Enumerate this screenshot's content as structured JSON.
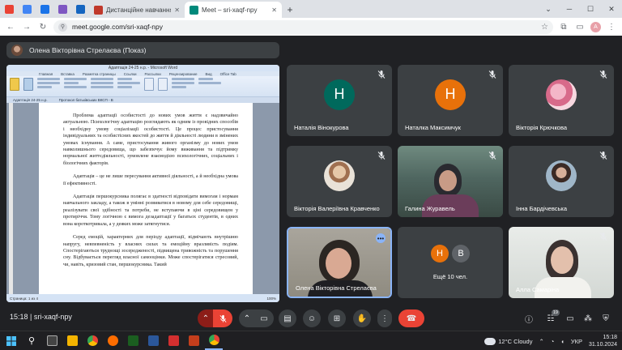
{
  "browser": {
    "tabs": [
      {
        "title": "Дистанційне навчання в ВСП",
        "favicon_color": "#c0392b"
      },
      {
        "title": "Meet – sri-xaqf-npy",
        "favicon_color": "#00897b"
      }
    ],
    "mini_tab_colors": [
      "#ea4335",
      "#4285f4",
      "#1a73e8",
      "#7e57c2",
      "#1565c0"
    ],
    "url": "meet.google.com/sri-xaqf-npy",
    "profile_initial": "A"
  },
  "meet": {
    "presenter_label": "Олена Вікторівна Стрелаєва (Показ)",
    "document": {
      "title_bar": "Адаптація 24-25 н.р. - Microsoft Word",
      "ribbon_tabs": [
        "Главная",
        "Вставка",
        "Разметка страницы",
        "Ссылки",
        "Рассылки",
        "Рецензирование",
        "Вид",
        "Office Tab"
      ],
      "doc_tabs": [
        "Адаптація 24-25 н.р.",
        "Протокол батьківських ВКСП - В"
      ],
      "paragraphs": [
        "Проблема адаптації особистості до нових умов життя є надзвичайно актуальною. Психологічну адаптацію розглядають як одним із провідних способів і необхідну умову соціалізації особистості. Це процес пристосування індивідуальних та особистісних якостей до життя й діяльності людини в змінених умовах існування. А саме, пристосування живого організму до нових умов навколишнього середовища, що забезпечує йому виживання та підтримку нормальної життєдіяльності, зумовлене взаємодією психологічних, соціальних і біологічних факторів.",
        "Адаптація – це не лише пересування активної діяльності, а й необхідна умова її ефективності.",
        "Адаптація першокурсника полягає в здатності відповідати вимогам і нормам навчального закладу, а також в умінні розвиватися в новому для себе середовищі, реалізувати свої здібності та потреби, не вступаючи в ціні середовищем у протиріччя. Тому логічною є вимога дезадаптації у багатьох студентів, в одних вона короткотривала, а у деяких може затягнутися.",
        "Серед емоцій, характерних для періоду адаптації, відмічають внутрішню напругу, невпевненість у власних силах та емоційну вразливість подіям. Спостерігаються труднощі зосередженості, підвищена тривожність та порушення сну. Відбувається перегляд власної самооцінки. Може спостерігатися стресовий, чи, навіть, кризовий стан, першокурсника. Такий"
      ],
      "status_left": "Страница: 1 из 4",
      "status_right": "100%"
    },
    "tiles": [
      {
        "name": "Наталія Вінокурова",
        "initial": "Н",
        "avatar_color": "#00695c",
        "kind": "letter"
      },
      {
        "name": "Наталка Максимчук",
        "initial": "Н",
        "avatar_color": "#e8710a",
        "kind": "letter"
      },
      {
        "name": "Вікторія Крючкова",
        "initial": "",
        "avatar_color": "#d88aa0",
        "kind": "photo"
      },
      {
        "name": "Вікторія Валеріївна Кравченко",
        "initial": "",
        "avatar_color": "#c9b49a",
        "kind": "photo"
      },
      {
        "name": "Галина Журавель",
        "initial": "",
        "avatar_color": "",
        "kind": "video"
      },
      {
        "name": "Інна Бардічевська",
        "initial": "",
        "avatar_color": "#7a5c4e",
        "kind": "photo"
      },
      {
        "name": "Олена Вікторівна Стрелаєва",
        "initial": "",
        "avatar_color": "",
        "kind": "video"
      },
      {
        "name": "Ещё 10 чел.",
        "initial": "",
        "avatar_color": "",
        "kind": "group"
      },
      {
        "name": "Алла Самаріна",
        "initial": "",
        "avatar_color": "",
        "kind": "video"
      }
    ],
    "group_initials": [
      {
        "letter": "Н",
        "color": "#e8710a"
      },
      {
        "letter": "В",
        "color": "#5f6368"
      }
    ],
    "bottom": {
      "time_and_code": "15:18  |  sri-xaqf-npy",
      "participants_count": "19"
    }
  },
  "taskbar": {
    "weather": "12°C  Cloudy",
    "lang": "УКР",
    "time": "15:18",
    "date": "31.10.2024",
    "app_colors": [
      "#2b6cd6",
      "#e0a800",
      "#f4b400",
      "#ff6d00",
      "#1b5e20",
      "#2b579a",
      "#d32f2f",
      "#d32f2f",
      "#4285f4"
    ]
  }
}
